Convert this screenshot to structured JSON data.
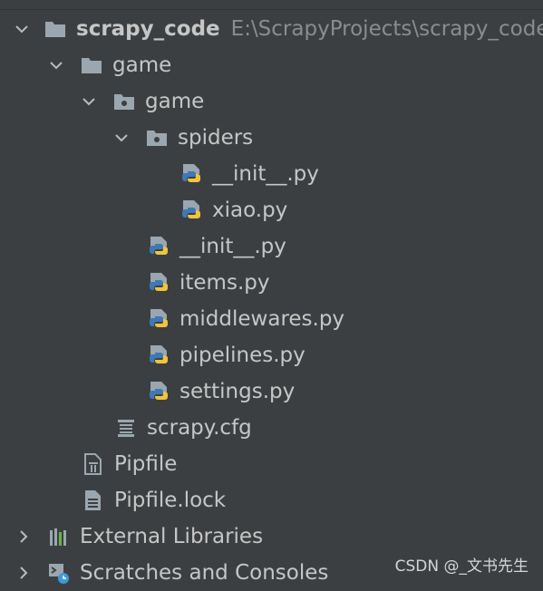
{
  "project": {
    "root": {
      "name": "scrapy_code",
      "path": "E:\\ScrapyProjects\\scrapy_code"
    },
    "items": [
      {
        "name": "game",
        "indent": 1,
        "type": "folder",
        "expanded": true
      },
      {
        "name": "game",
        "indent": 2,
        "type": "package",
        "expanded": true
      },
      {
        "name": "spiders",
        "indent": 3,
        "type": "package",
        "expanded": true
      },
      {
        "name": "__init__.py",
        "indent": 4,
        "type": "python"
      },
      {
        "name": "xiao.py",
        "indent": 4,
        "type": "python"
      },
      {
        "name": "__init__.py",
        "indent": 3,
        "type": "python"
      },
      {
        "name": "items.py",
        "indent": 3,
        "type": "python"
      },
      {
        "name": "middlewares.py",
        "indent": 3,
        "type": "python"
      },
      {
        "name": "pipelines.py",
        "indent": 3,
        "type": "python"
      },
      {
        "name": "settings.py",
        "indent": 3,
        "type": "python"
      },
      {
        "name": "scrapy.cfg",
        "indent": 2,
        "type": "config"
      },
      {
        "name": "Pipfile",
        "indent": 1,
        "type": "pipfile"
      },
      {
        "name": "Pipfile.lock",
        "indent": 1,
        "type": "text"
      }
    ],
    "external_libraries": {
      "label": "External Libraries"
    },
    "scratches": {
      "label": "Scratches and Consoles"
    }
  },
  "watermark": "CSDN @_文书先生",
  "icons": {
    "folder": "folder-icon",
    "package": "package-folder-icon",
    "python": "python-file-icon",
    "config": "config-file-icon",
    "pipfile": "pipfile-icon",
    "text": "text-file-icon",
    "libraries": "libraries-icon",
    "scratches": "scratches-icon"
  },
  "colors": {
    "background": "#3c3f41",
    "text": "#c6c6c6",
    "path": "#8c8c8c",
    "folder": "#9aa7b0",
    "python_blue": "#3f78b7",
    "python_yellow": "#f0c43c"
  }
}
